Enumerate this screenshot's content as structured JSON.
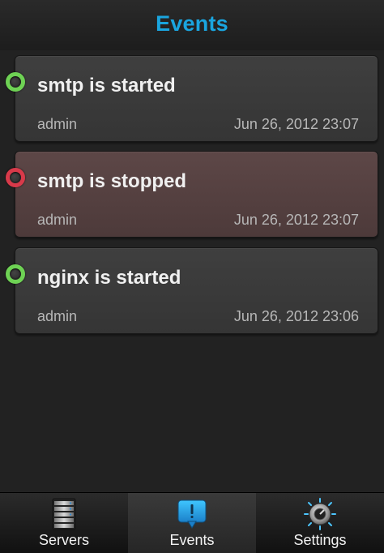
{
  "header": {
    "title": "Events"
  },
  "events": [
    {
      "title": "smtp is started",
      "user": "admin",
      "time": "Jun 26, 2012 23:07",
      "status": "started"
    },
    {
      "title": "smtp is stopped",
      "user": "admin",
      "time": "Jun 26, 2012 23:07",
      "status": "stopped"
    },
    {
      "title": "nginx is started",
      "user": "admin",
      "time": "Jun 26, 2012 23:06",
      "status": "started"
    }
  ],
  "tabs": [
    {
      "label": "Servers",
      "icon": "server-rack-icon",
      "selected": false
    },
    {
      "label": "Events",
      "icon": "events-alert-icon",
      "selected": true
    },
    {
      "label": "Settings",
      "icon": "settings-gear-icon",
      "selected": false
    }
  ],
  "colors": {
    "accent": "#1aa5df",
    "status_started": "#6ed254",
    "status_stopped": "#d83a4a",
    "stopped_card": "#5d4747"
  }
}
